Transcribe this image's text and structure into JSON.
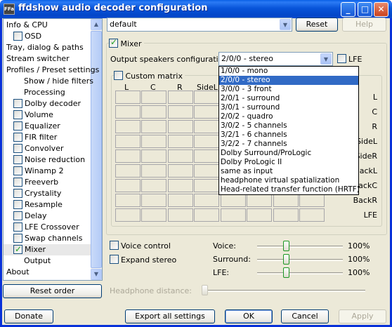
{
  "window": {
    "title": "ffdshow audio decoder configuration",
    "icon_text": "FFa",
    "controls": {
      "minimize": "_",
      "maximize": "□",
      "close": "✕"
    }
  },
  "sidebar": {
    "items": [
      {
        "label": "Info & CPU",
        "check": null,
        "indent": 0
      },
      {
        "label": "OSD",
        "check": false,
        "indent": 1
      },
      {
        "label": "Tray, dialog & paths",
        "check": null,
        "indent": 0
      },
      {
        "label": "Stream switcher",
        "check": null,
        "indent": 0
      },
      {
        "label": "Profiles / Preset settings",
        "check": null,
        "indent": 0
      },
      {
        "label": "Show / hide filters",
        "check": null,
        "indent": 2
      },
      {
        "label": "Processing",
        "check": null,
        "indent": 2
      },
      {
        "label": "Dolby decoder",
        "check": false,
        "indent": 1
      },
      {
        "label": "Volume",
        "check": false,
        "indent": 1
      },
      {
        "label": "Equalizer",
        "check": false,
        "indent": 1
      },
      {
        "label": "FIR filter",
        "check": false,
        "indent": 1
      },
      {
        "label": "Convolver",
        "check": false,
        "indent": 1
      },
      {
        "label": "Noise reduction",
        "check": false,
        "indent": 1
      },
      {
        "label": "Winamp 2",
        "check": false,
        "indent": 1
      },
      {
        "label": "Freeverb",
        "check": false,
        "indent": 1
      },
      {
        "label": "Crystality",
        "check": false,
        "indent": 1
      },
      {
        "label": "Resample",
        "check": false,
        "indent": 1
      },
      {
        "label": "Delay",
        "check": false,
        "indent": 1
      },
      {
        "label": "LFE Crossover",
        "check": false,
        "indent": 1
      },
      {
        "label": "Swap channels",
        "check": false,
        "indent": 1
      },
      {
        "label": "Mixer",
        "check": true,
        "indent": 1,
        "selected": true
      },
      {
        "label": "Output",
        "check": null,
        "indent": 2
      },
      {
        "label": "About",
        "check": null,
        "indent": 0
      }
    ],
    "reset_order": "Reset order"
  },
  "preset": {
    "value": "default",
    "reset": "Reset",
    "help": "Help"
  },
  "mixer": {
    "enabled_label": "Mixer",
    "output_label": "Output speakers configuration:",
    "output_value": "2/0/0 - stereo",
    "lfe_label": "LFE",
    "custom_matrix_label": "Custom matrix",
    "columns": [
      "L",
      "C",
      "R",
      "SideL"
    ],
    "rows": [
      "L",
      "C",
      "R",
      "SideL",
      "SideR",
      "BackL",
      "BackC",
      "BackR",
      "LFE"
    ],
    "dropdown_options": [
      "1/0/0 - mono",
      "2/0/0 - stereo",
      "3/0/0 - 3 front",
      "2/0/1 - surround",
      "3/0/1 - surround",
      "2/0/2 - quadro",
      "3/0/2 - 5 channels",
      "3/2/1 - 6 channels",
      "3/2/2 - 7 channels",
      "Dolby Surround/ProLogic",
      "Dolby ProLogic II",
      "same as input",
      "headphone virtual spatialization",
      "Head-related transfer function (HRTF)"
    ],
    "dropdown_selected": 1,
    "voice_control_label": "Voice control",
    "expand_stereo_label": "Expand stereo",
    "voice_label": "Voice:",
    "voice_value": "100%",
    "voice_level": 0.5,
    "surround_label": "Surround:",
    "surround_value": "100%",
    "surround_level": 0.5,
    "lfe_slider_label": "LFE:",
    "lfe_value": "100%",
    "lfe_level": 0.5,
    "headphone_distance_label": "Headphone distance:",
    "headphone_distance_level": 0
  },
  "footer": {
    "donate": "Donate",
    "export": "Export all settings",
    "ok": "OK",
    "cancel": "Cancel",
    "apply": "Apply"
  },
  "colors": {
    "titlebar": "#0854d9",
    "selection": "#316ac5",
    "dialog_bg": "#ece9d8"
  }
}
